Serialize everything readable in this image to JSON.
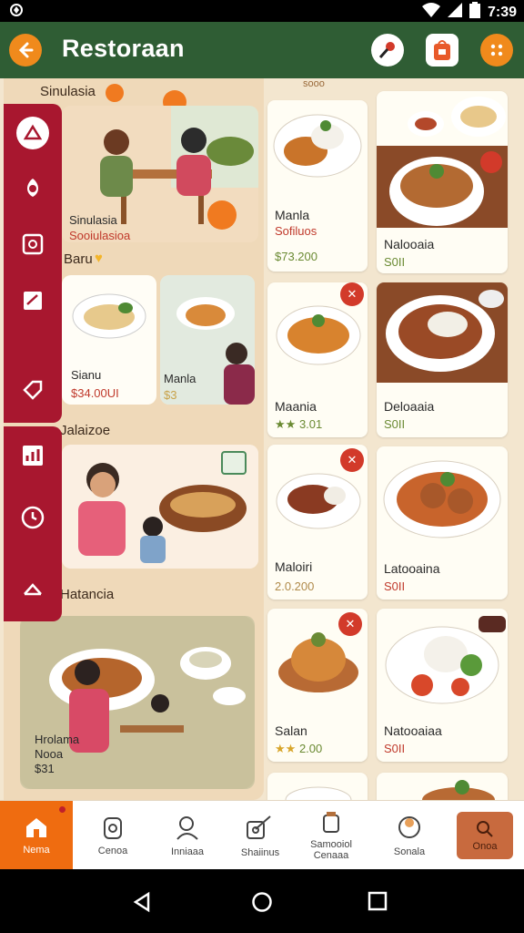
{
  "status_bar": {
    "left_icon": "android-debug-icon",
    "time": "7:39"
  },
  "app_bar": {
    "title": "Restoraan",
    "icons": [
      "back-arrow-icon",
      "map-pin-icon",
      "shopping-bag-icon",
      "more-icon"
    ]
  },
  "category_strip": "sooo",
  "left_panel": {
    "top_heading": "Sinulasia",
    "card1_caption": "Sinulasia",
    "card1_price": "Sooiulasioa",
    "section2_label": "Baru",
    "card2a_name": "Sianu",
    "card2a_price": "$34.00UI",
    "card2b_name": "Manla",
    "card2b_price": "$3",
    "section3_label": "Jalaizoe",
    "section4_label": "Hatancia",
    "card4_name": "Hrolama",
    "card4_sub": "Nooa",
    "card4_price": "$31"
  },
  "products": [
    {
      "name": "Manla",
      "sub": "Sofiluos",
      "price": "$73.200"
    },
    {
      "name": "Nalooaia",
      "price": "S0II"
    },
    {
      "name": "Maania",
      "price": "3.01"
    },
    {
      "name": "Deloaaia",
      "price": "S0II"
    },
    {
      "name": "Maloiri",
      "price": "2.0.200"
    },
    {
      "name": "Latooaina",
      "price": "S0II"
    },
    {
      "name": "Salan",
      "price": "2.00"
    },
    {
      "name": "Natooaiaa",
      "price": "S0II"
    }
  ],
  "bottom_nav": [
    {
      "label": "Nema",
      "icon": "home-icon"
    },
    {
      "label": "Cenoa",
      "icon": "jar-icon"
    },
    {
      "label": "Inniaaa",
      "icon": "person-icon"
    },
    {
      "label": "Shaiinus",
      "icon": "share-icon"
    },
    {
      "label": "Samooiol Cenaaa",
      "icon": "drink-icon"
    },
    {
      "label": "Sonala",
      "icon": "bowl-icon"
    },
    {
      "label": "Onoa",
      "icon": "search-icon"
    }
  ],
  "colors": {
    "appbar": "#2f5d34",
    "accent": "#f08a1c",
    "rail": "#a8172f",
    "home_tab": "#ef6c10",
    "price_green": "#6a8a32"
  }
}
